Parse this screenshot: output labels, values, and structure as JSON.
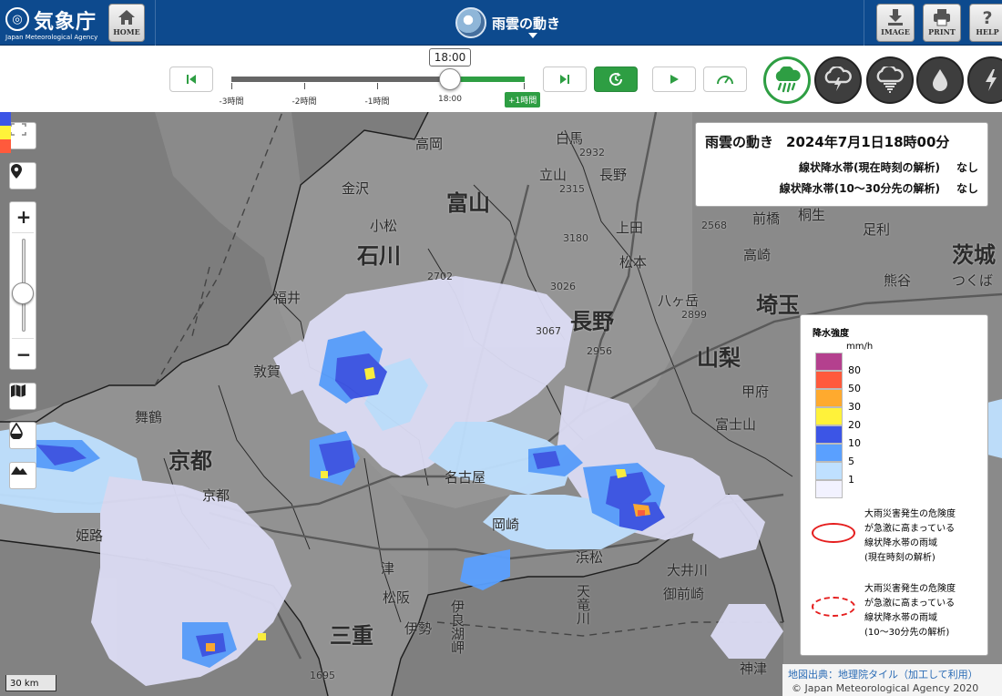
{
  "header": {
    "logo_mark": "JMA",
    "logo_name": "気象庁",
    "logo_en": "Japan Meteorological Agency",
    "home_label": "HOME",
    "title": "雨雲の動き",
    "image_label": "IMAGE",
    "print_label": "PRINT",
    "help_label": "HELP"
  },
  "controls": {
    "current_time": "18:00",
    "ticks": [
      "-3時間",
      "-2時間",
      "-1時間",
      "18:00"
    ],
    "future_tick": "+1時間",
    "progress_fraction": 0.75
  },
  "info": {
    "title": "雨雲の動き",
    "datetime": "2024年7月1日18時00分",
    "rows": [
      {
        "label": "線状降水帯(現在時刻の解析)",
        "value": "なし"
      },
      {
        "label": "線状降水帯(10〜30分先の解析)",
        "value": "なし"
      }
    ]
  },
  "legend": {
    "title": "降水強度",
    "unit": "mm/h",
    "levels": [
      {
        "label": "80",
        "color": "#b4408e"
      },
      {
        "label": "50",
        "color": "#ff5a3c"
      },
      {
        "label": "30",
        "color": "#ffaa2e"
      },
      {
        "label": "20",
        "color": "#fff23a"
      },
      {
        "label": "10",
        "color": "#3c55e6"
      },
      {
        "label": "5",
        "color": "#5aa0ff"
      },
      {
        "label": "1",
        "color": "#bfe0ff"
      },
      {
        "label": "",
        "color": "#f2f2ff"
      }
    ],
    "note_current": [
      "大雨災害発生の危険度",
      "が急激に高まっている",
      "線状降水帯の雨域",
      "(現在時刻の解析)"
    ],
    "note_future": [
      "大雨災害発生の危険度",
      "が急激に高まっている",
      "線状降水帯の雨域",
      "(10〜30分先の解析)"
    ]
  },
  "map": {
    "scale": "30 km",
    "credit_map": "地図出典：地理院タイル（加工して利用）",
    "credit_copy": "© Japan Meteorological Agency 2020",
    "prefectures": [
      "富山",
      "石川",
      "長野",
      "山梨",
      "埼玉",
      "京都",
      "三重",
      "茨城"
    ],
    "cities": [
      "高岡",
      "白馬",
      "金沢",
      "立山",
      "長野",
      "小松",
      "上田",
      "前橋",
      "桐生",
      "足利",
      "高崎",
      "松本",
      "福井",
      "八ヶ岳",
      "熊谷",
      "つくば",
      "甲府",
      "舞鶴",
      "敦賀",
      "富士山",
      "京都",
      "名古屋",
      "岡崎",
      "浜松",
      "伊良湖岬",
      "御前崎",
      "天竜川",
      "大井川",
      "姫路",
      "津",
      "松阪",
      "伊勢",
      "神津"
    ],
    "elevations": [
      "2932",
      "3180",
      "3026",
      "3067",
      "2956",
      "2899",
      "2568",
      "2702",
      "1695",
      "2315"
    ]
  }
}
